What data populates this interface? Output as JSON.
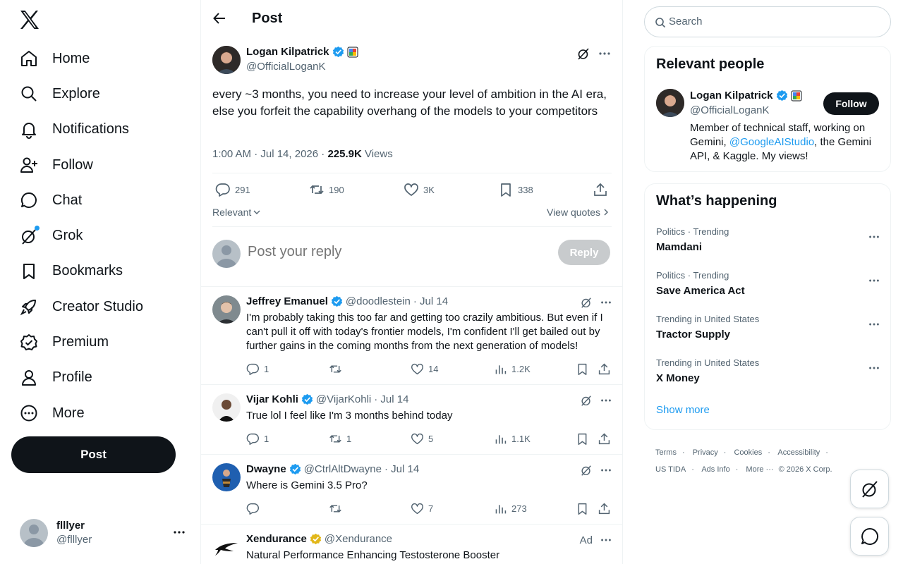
{
  "nav": {
    "items": [
      {
        "label": "Home",
        "icon": "home-icon"
      },
      {
        "label": "Explore",
        "icon": "search-icon"
      },
      {
        "label": "Notifications",
        "icon": "bell-icon"
      },
      {
        "label": "Follow",
        "icon": "add-person-icon"
      },
      {
        "label": "Chat",
        "icon": "chat-bubble-icon"
      },
      {
        "label": "Grok",
        "icon": "grok-icon"
      },
      {
        "label": "Bookmarks",
        "icon": "bookmark-icon"
      },
      {
        "label": "Creator Studio",
        "icon": "rocket-icon"
      },
      {
        "label": "Premium",
        "icon": "verified-badge-icon"
      },
      {
        "label": "Profile",
        "icon": "person-icon"
      },
      {
        "label": "More",
        "icon": "more-circle-icon"
      }
    ],
    "post_label": "Post"
  },
  "account": {
    "name": "flllyer",
    "handle": "@flllyer"
  },
  "header": {
    "title": "Post"
  },
  "main_post": {
    "author": "Logan Kilpatrick",
    "handle": "@OfficialLoganK",
    "text": "every ~3 months, you need to increase your level of ambition in the AI era, else you forfeit the capability overhang of the models to your competitors",
    "time": "1:00 AM · Jul 14, 2026 · ",
    "views_count": "225.9K",
    "views_label": " Views",
    "replies": "291",
    "reposts": "190",
    "likes": "3K",
    "bookmarks": "338",
    "sort_label": "Relevant",
    "view_quotes": "View quotes"
  },
  "reply_box": {
    "placeholder": "Post your reply",
    "button": "Reply"
  },
  "replies": [
    {
      "name": "Jeffrey Emanuel",
      "handle": "@doodlestein",
      "date": "· Jul 14",
      "text": "I'm probably taking this too far and getting too crazily ambitious. But even if I can't pull it off with today's frontier models, I'm confident I'll get bailed out by further gains in the coming months from the next generation of models!",
      "replies": "1",
      "reposts": "",
      "likes": "14",
      "views": "1.2K"
    },
    {
      "name": "Vijar Kohli",
      "handle": "@VijarKohli",
      "date": "· Jul 14",
      "text": "True lol I feel like I'm 3 months behind today",
      "replies": "1",
      "reposts": "1",
      "likes": "5",
      "views": "1.1K"
    },
    {
      "name": "Dwayne",
      "handle": "@CtrlAltDwayne",
      "date": "· Jul 14",
      "text": "Where is Gemini 3.5 Pro?",
      "replies": "",
      "reposts": "",
      "likes": "7",
      "views": "273"
    },
    {
      "name": "Xendurance",
      "handle": "@Xendurance",
      "date": "",
      "ad_label": "Ad",
      "text": "Natural Performance Enhancing Testosterone Booster"
    }
  ],
  "search": {
    "placeholder": "Search"
  },
  "relevant_people": {
    "title": "Relevant people",
    "name": "Logan Kilpatrick",
    "handle": "@OfficialLoganK",
    "follow": "Follow",
    "bio_pre": "Member of technical staff, working on Gemini, ",
    "bio_link": "@GoogleAIStudio",
    "bio_post": ", the Gemini API, & Kaggle. My views!"
  },
  "happening": {
    "title": "What’s happening",
    "trends": [
      {
        "context": "Politics · Trending",
        "title": "Mamdani"
      },
      {
        "context": "Politics · Trending",
        "title": "Save America Act"
      },
      {
        "context": "Trending in United States",
        "title": "Tractor Supply"
      },
      {
        "context": "Trending in United States",
        "title": "X Money"
      }
    ],
    "show_more": "Show more"
  },
  "footer": {
    "links": [
      "Terms",
      "Privacy",
      "Cookies",
      "Accessibility",
      "US TIDA",
      "Ads Info",
      "More ···"
    ],
    "copyright": "© 2026 X Corp."
  },
  "colors": {
    "accent": "#1d9bf0",
    "text": "#0f1419",
    "secondary": "#536471",
    "gold_badge": "#e2b719"
  }
}
